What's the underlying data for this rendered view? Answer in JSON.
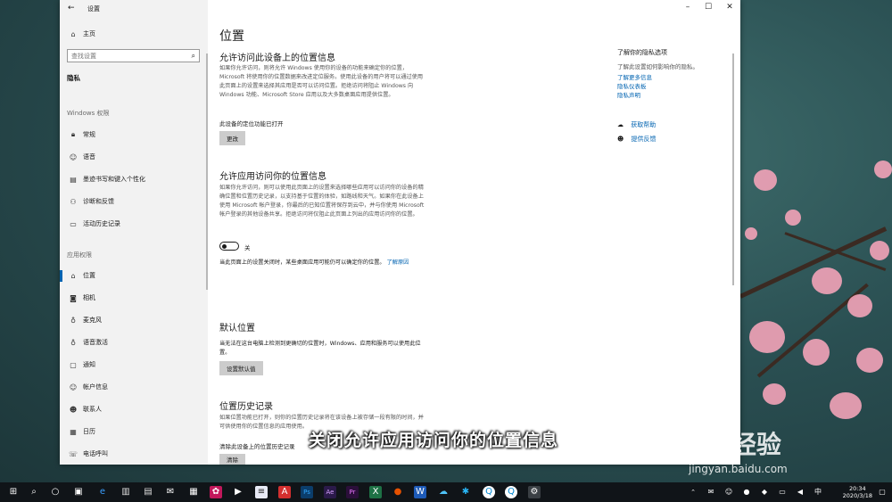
{
  "window": {
    "title": "设置"
  },
  "sidebar": {
    "home": "主页",
    "search_placeholder": "查找设置",
    "category": "隐私",
    "windows_section": "Windows 权限",
    "windows_items": [
      "常规",
      "语音",
      "墨迹书写和键入个性化",
      "诊断和反馈",
      "活动历史记录"
    ],
    "app_section": "应用权限",
    "app_items": [
      "位置",
      "相机",
      "麦克风",
      "语音激活",
      "通知",
      "帐户信息",
      "联系人",
      "日历",
      "电话呼叫"
    ]
  },
  "main": {
    "title": "位置",
    "device_section": {
      "heading": "允许访问此设备上的位置信息",
      "desc": "如果你允许访问，则将允许 Windows 使用你的设备的功能来确定你的位置，Microsoft 将使用你的位置数据来改进定位服务。使用此设备的用户将可以通过使用此页面上的设置来选择其应用是否可以访问位置。拒绝访问将阻止 Windows 向 Windows 功能、Microsoft Store 应用以及大多数桌面应用提供位置。",
      "status": "此设备的定位功能已打开",
      "button": "更改"
    },
    "app_section": {
      "heading": "允许应用访问你的位置信息",
      "desc": "如果你允许访问，则可以使用此页面上的设置来选择哪些应用可以访问你的设备的精确位置和位置历史记录，以支持基于位置的体验，如路线和天气。如果你在此设备上使用 Microsoft 帐户登录，你最后的已知位置将保存到云中，并与你使用 Microsoft 帐户登录的其他设备共享。拒绝访问将仅阻止此页面上列出的应用访问你的位置。",
      "toggle_label": "关",
      "note": "当此页面上的设置关闭时，某些桌面应用可能仍可以确定你的位置。",
      "note_link": "了解原因"
    },
    "default_section": {
      "heading": "默认位置",
      "desc": "当无法在这台电脑上检测到更确切的位置时，Windows、应用和服务可以使用此位置。",
      "button": "设置默认值"
    },
    "history_section": {
      "heading": "位置历史记录",
      "desc": "如果位置功能已打开，则你的位置历史记录将在该设备上被存储一段有限的时间，并可供使用你的位置信息的应用使用。",
      "label": "清除此设备上的位置历史记录",
      "button": "清除"
    }
  },
  "right_panel": {
    "heading": "了解你的隐私选项",
    "desc": "了解此设置如何影响你的隐私。",
    "links": [
      "了解更多信息",
      "隐私仪表板",
      "隐私声明"
    ],
    "help": "获取帮助",
    "feedback": "提供反馈"
  },
  "caption": "关闭允许应用访问你的位置信息",
  "watermark": {
    "brand": "Bai经验",
    "url": "jingyan.baidu.com"
  },
  "taskbar": {
    "time": "20:34",
    "date": "2020/3/18"
  }
}
